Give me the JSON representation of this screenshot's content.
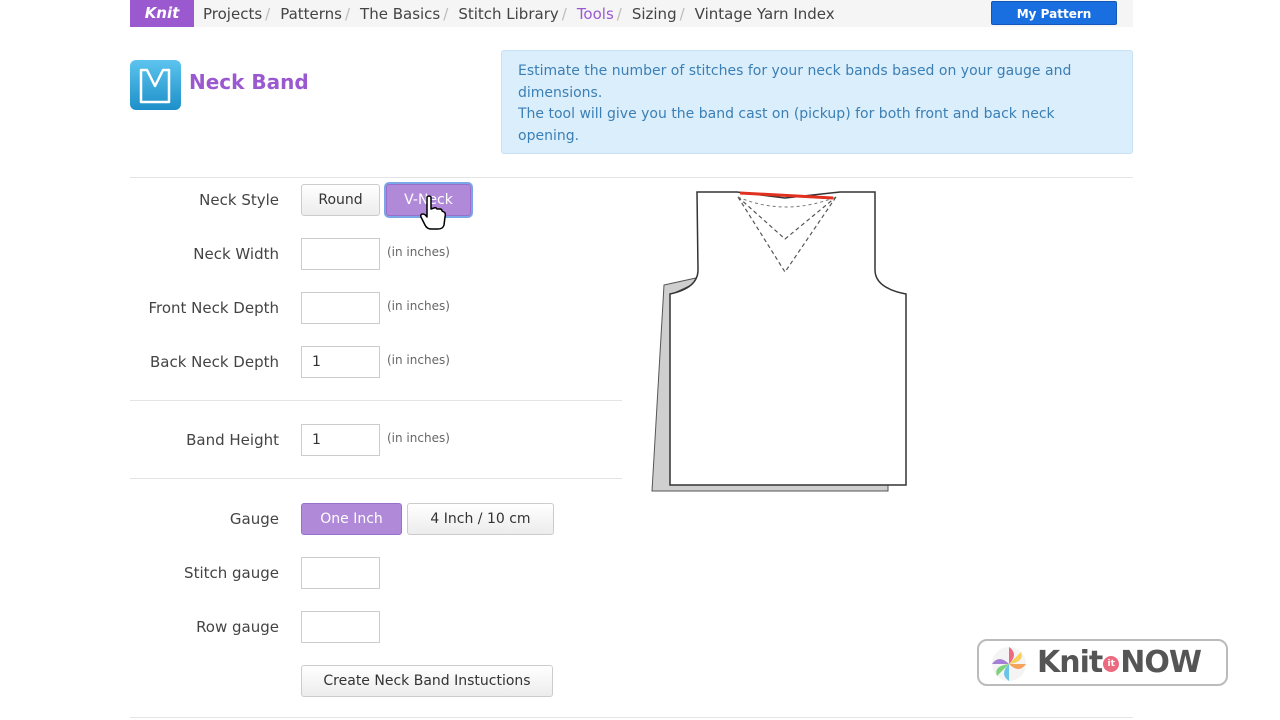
{
  "nav": {
    "brand": "Knit",
    "items": [
      {
        "label": "Projects",
        "active": false
      },
      {
        "label": "Patterns",
        "active": false
      },
      {
        "label": "The Basics",
        "active": false
      },
      {
        "label": "Stitch Library",
        "active": false
      },
      {
        "label": "Tools",
        "active": true
      },
      {
        "label": "Sizing",
        "active": false
      },
      {
        "label": "Vintage Yarn Index",
        "active": false
      }
    ],
    "library_button": "My Pattern Library"
  },
  "page": {
    "title": "Neck Band",
    "info_line1": "Estimate the number of stitches for your neck bands based on your gauge and dimensions.",
    "info_line2": "The tool will give you the band cast on (pickup) for both front and back neck opening."
  },
  "form": {
    "neck_style_label": "Neck Style",
    "neck_style_options": [
      "Round",
      "V-Neck"
    ],
    "neck_style_selected": "V-Neck",
    "neck_width_label": "Neck Width",
    "neck_width_value": "",
    "front_depth_label": "Front Neck Depth",
    "front_depth_value": "",
    "back_depth_label": "Back Neck Depth",
    "back_depth_value": "1",
    "band_height_label": "Band Height",
    "band_height_value": "1",
    "unit_hint": "(in inches)",
    "gauge_label": "Gauge",
    "gauge_options": [
      "One Inch",
      "4 Inch / 10 cm"
    ],
    "gauge_selected": "One Inch",
    "stitch_gauge_label": "Stitch gauge",
    "stitch_gauge_value": "",
    "row_gauge_label": "Row gauge",
    "row_gauge_value": "",
    "submit_label": "Create Neck Band Instuctions"
  },
  "watermark": {
    "text_a": "Knit",
    "text_it": "it",
    "text_b": "NOW"
  },
  "colors": {
    "accent": "#9b59d0",
    "info_bg": "#dbeefb",
    "info_text": "#3b7fb5",
    "library_btn": "#1a6fe0",
    "band_line": "#e0301e"
  },
  "icons": [
    "vneck-sweater-icon",
    "hand-pointer-icon",
    "yarn-ball-logo-icon"
  ]
}
